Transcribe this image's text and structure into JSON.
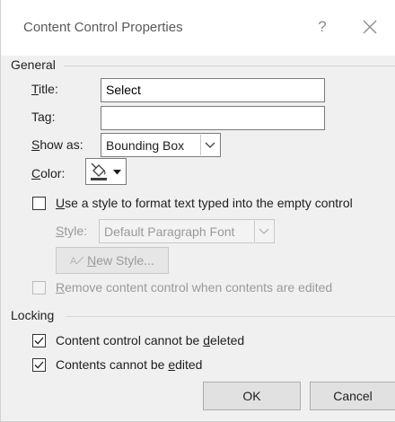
{
  "dialog": {
    "title": "Content Control Properties",
    "help_label": "?",
    "close_label": "✕"
  },
  "general": {
    "group_label": "General",
    "title_label_u": "T",
    "title_label_rest": "itle:",
    "title_value": "Select",
    "tag_label_pre": "Ta",
    "tag_label_u": "g",
    "tag_label_rest": ":",
    "tag_value": "",
    "show_as_label_u": "S",
    "show_as_label_rest": "how as:",
    "show_as_value": "Bounding Box",
    "color_label_u": "C",
    "color_label_rest": "olor:",
    "use_style_label_u": "U",
    "use_style_label_rest": "se a style to format text typed into the empty control",
    "use_style_checked": false,
    "style_label_u": "S",
    "style_label_rest": "tyle:",
    "style_value": "Default Paragraph Font",
    "new_style_label_u": "N",
    "new_style_label_rest": "ew Style...",
    "remove_label_u": "R",
    "remove_label_rest": "emove content control when contents are edited",
    "remove_checked": false
  },
  "locking": {
    "group_label": "Locking",
    "cannot_delete_pre": "Content control cannot be ",
    "cannot_delete_u": "d",
    "cannot_delete_rest": "eleted",
    "cannot_delete_checked": true,
    "cannot_edit_pre": "Contents cannot be ",
    "cannot_edit_u": "e",
    "cannot_edit_rest": "dited",
    "cannot_edit_checked": true
  },
  "footer": {
    "ok_label": "OK",
    "cancel_label": "Cancel"
  }
}
